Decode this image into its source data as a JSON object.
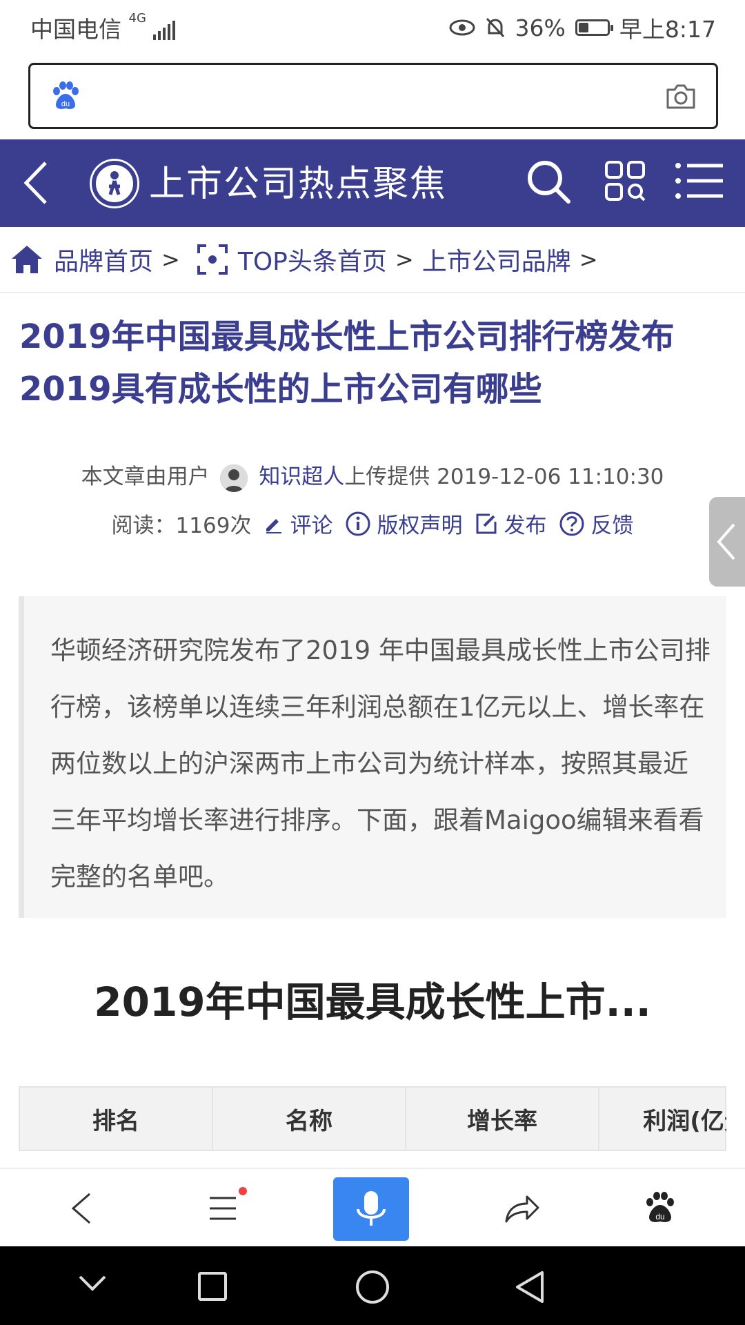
{
  "status_bar": {
    "carrier": "中国电信",
    "network": "4G",
    "battery": "36%",
    "battery_level": 0.36,
    "time": "早上8:17"
  },
  "search": {
    "placeholder": "",
    "icons": [
      "baidu-paw-icon",
      "camera-icon"
    ]
  },
  "header": {
    "title": "上市公司热点聚焦",
    "icons": [
      "back-icon",
      "maigoo-logo",
      "search-icon",
      "grid-icon",
      "menu-icon"
    ]
  },
  "breadcrumb": {
    "items": [
      "品牌首页",
      "TOP头条首页",
      "上市公司品牌"
    ],
    "separator": ">"
  },
  "article": {
    "title_line1": "2019年中国最具成长性上市公司排行榜发布",
    "title_line2": "2019具有成长性的上市公司有哪些",
    "byline_prefix": "本文章由用户",
    "author": "知识超人",
    "byline_suffix": "上传提供 2019-12-06 11:10:30",
    "reads": "阅读：1169次",
    "actions": {
      "comment": "评论",
      "copyright": "版权声明",
      "publish": "发布",
      "feedback": "反馈"
    },
    "summary": "华顿经济研究院发布了2019 年中国最具成长性上市公司排行榜，该榜单以连续三年利润总额在1亿元以上、增长率在两位数以上的沪深两市上市公司为统计样本，按照其最近三年平均增长率进行排序。下面，跟着Maigoo编辑来看看完整的名单吧。",
    "section_title": "2019年中国最具成长性上市..."
  },
  "table": {
    "headers": [
      "排名",
      "名称",
      "增长率",
      "利润(亿元"
    ]
  },
  "colors": {
    "brand": "#3b3d8f",
    "mic": "#3a86f0"
  }
}
